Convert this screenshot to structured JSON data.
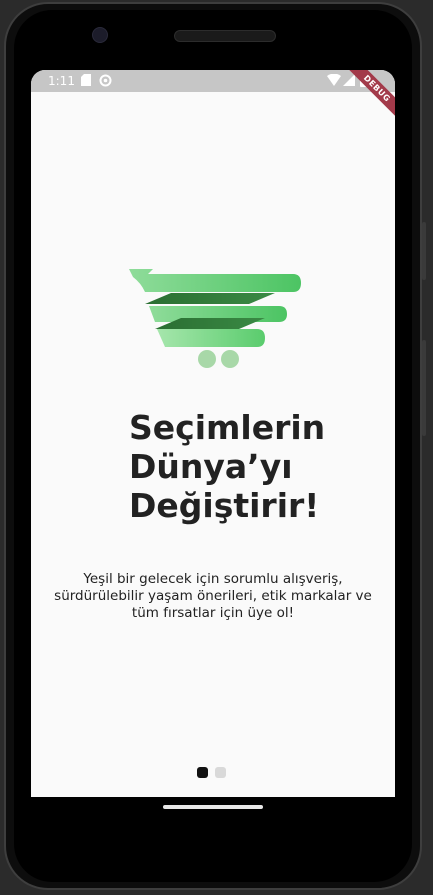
{
  "status_bar": {
    "time": "1:11",
    "icons": [
      "sd-card-icon",
      "settings-icon",
      "wifi-icon",
      "signal-icon",
      "battery-icon"
    ],
    "debug_banner": "DEBUG"
  },
  "onboarding": {
    "headline": "Seçimlerin Dünya’yı Değiştirir!",
    "subtitle": "Yeşil bir gelecek için sorumlu alışveriş, sürdürülebilir yaşam önerileri, etik markalar ve tüm fırsatlar için üye ol!",
    "page_indicator": {
      "total": 2,
      "active_index": 0
    }
  },
  "colors": {
    "screen_bg": "#fafafa",
    "status_bar_bg": "#c6c6c6",
    "headline": "#222222",
    "logo_light_green": "#7fd68c",
    "logo_dark_green": "#2f7a38",
    "logo_wheels": "#a8d8a8",
    "dot_active": "#111111",
    "dot_inactive": "#d9d9d9",
    "debug_ribbon": "#a33a4a"
  }
}
